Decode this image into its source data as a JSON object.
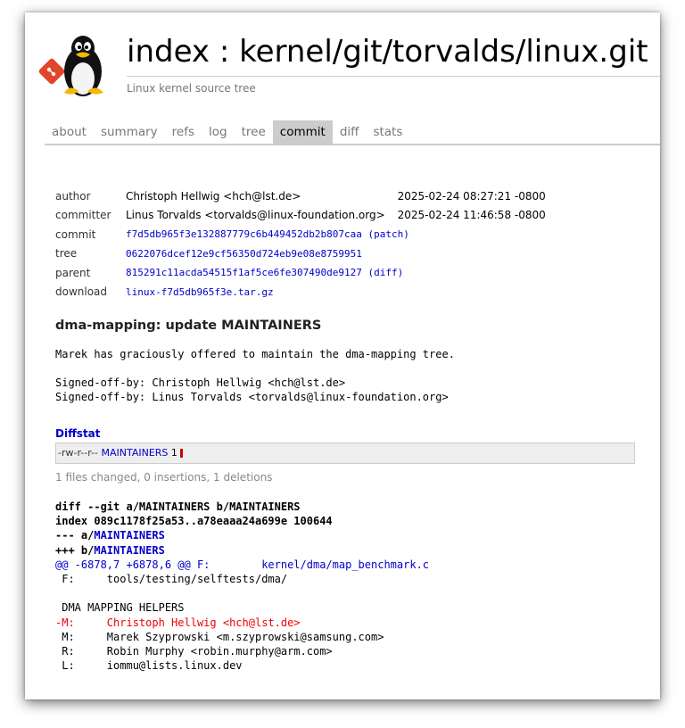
{
  "header": {
    "title": "index : kernel/git/torvalds/linux.git",
    "description": "Linux kernel source tree"
  },
  "tabs": [
    {
      "label": "about",
      "active": false
    },
    {
      "label": "summary",
      "active": false
    },
    {
      "label": "refs",
      "active": false
    },
    {
      "label": "log",
      "active": false
    },
    {
      "label": "tree",
      "active": false
    },
    {
      "label": "commit",
      "active": true
    },
    {
      "label": "diff",
      "active": false
    },
    {
      "label": "stats",
      "active": false
    }
  ],
  "commit_info": {
    "author_label": "author",
    "author": "Christoph Hellwig <hch@lst.de>",
    "author_date": "2025-02-24 08:27:21 -0800",
    "committer_label": "committer",
    "committer": "Linus Torvalds <torvalds@linux-foundation.org>",
    "committer_date": "2025-02-24 11:46:58 -0800",
    "commit_label": "commit",
    "commit": "f7d5db965f3e132887779c6b449452db2b807caa",
    "patch_link": "(patch)",
    "tree_label": "tree",
    "tree": "0622076dcef12e9cf56350d724eb9e08e8759951",
    "parent_label": "parent",
    "parent": "815291c11acda54515f1af5ce6fe307490de9127",
    "diff_link": "(diff)",
    "download_label": "download",
    "download": "linux-f7d5db965f3e.tar.gz"
  },
  "message": {
    "subject": "dma-mapping: update MAINTAINERS",
    "body_line1": "Marek has graciously offered to maintain the dma-mapping tree.",
    "signoff1": "Signed-off-by: Christoph Hellwig <hch@lst.de>",
    "signoff2": "Signed-off-by: Linus Torvalds <torvalds@linux-foundation.org>"
  },
  "diffstat": {
    "heading": "Diffstat",
    "mode": "-rw-r--r--",
    "file": "MAINTAINERS",
    "changes": "1",
    "summary": "1 files changed, 0 insertions, 1 deletions"
  },
  "diff": {
    "git_line": "diff --git a/MAINTAINERS b/MAINTAINERS",
    "index_line": "index 089c1178f25a53..a78eaaa24a699e 100644",
    "minus_prefix": "--- a/",
    "minus_file": "MAINTAINERS",
    "plus_prefix": "+++ b/",
    "plus_file": "MAINTAINERS",
    "hunk": "@@ -6878,7 +6878,6 @@ F:\tkernel/dma/map_benchmark.c",
    "ctx1": " F:\ttools/testing/selftests/dma/",
    "ctx2": " ",
    "ctx3": " DMA MAPPING HELPERS",
    "del1": "-M:\tChristoph Hellwig <hch@lst.de>",
    "ctx4": " M:\tMarek Szyprowski <m.szyprowski@samsung.com>",
    "ctx5": " R:\tRobin Murphy <robin.murphy@arm.com>",
    "ctx6": " L:\tiommu@lists.linux.dev"
  }
}
